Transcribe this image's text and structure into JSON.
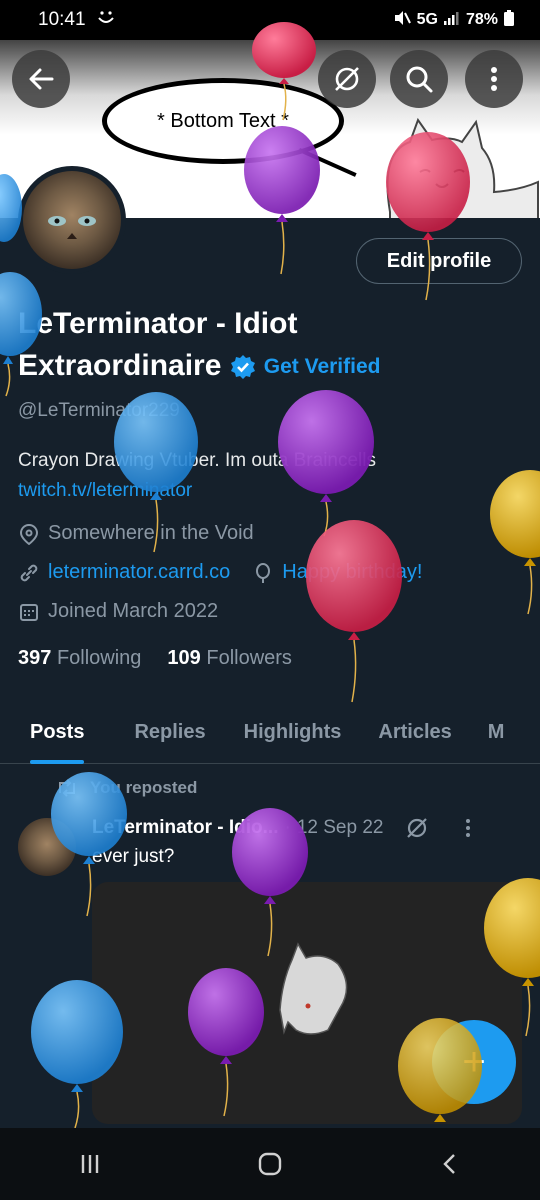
{
  "status_bar": {
    "time": "10:41",
    "network": "5G",
    "battery": "78%"
  },
  "banner": {
    "speech_text": "* Bottom Text *"
  },
  "header_buttons": [
    "back-arrow-icon",
    "no-eye-icon",
    "search-icon",
    "more-vert-icon"
  ],
  "profile": {
    "edit_label": "Edit profile",
    "name_line1": "LeTerminator - Idiot",
    "name_line2": "Extraordinaire",
    "get_verified": "Get Verified",
    "handle": "@LeTerminator229",
    "bio": "Crayon Drawing Vtuber.   Im outa Braincells",
    "bio_link": "twitch.tv/leterminator",
    "location": "Somewhere in the Void",
    "website": "leterminator.carrd.co",
    "birthday": "Happy birthday!",
    "joined": "Joined March 2022",
    "following_count": "397",
    "following_label": "Following",
    "followers_count": "109",
    "followers_label": "Followers"
  },
  "tabs": [
    {
      "label": "Posts",
      "active": true
    },
    {
      "label": "Replies"
    },
    {
      "label": "Highlights"
    },
    {
      "label": "Articles"
    },
    {
      "label": "M"
    }
  ],
  "post": {
    "reposted_label": "You reposted",
    "author": "LeTerminator - Idio...",
    "separator": "·",
    "date": "12 Sep 22",
    "text": "ever just?"
  },
  "fab_label": "+",
  "colors": {
    "background": "#15202b",
    "accent": "#1d9bf0",
    "muted": "#8b98a5",
    "balloon_blue": "#2e9be6",
    "balloon_purple": "#9b32d6",
    "balloon_red": "#e8345d",
    "balloon_yellow": "#e2b21c"
  }
}
